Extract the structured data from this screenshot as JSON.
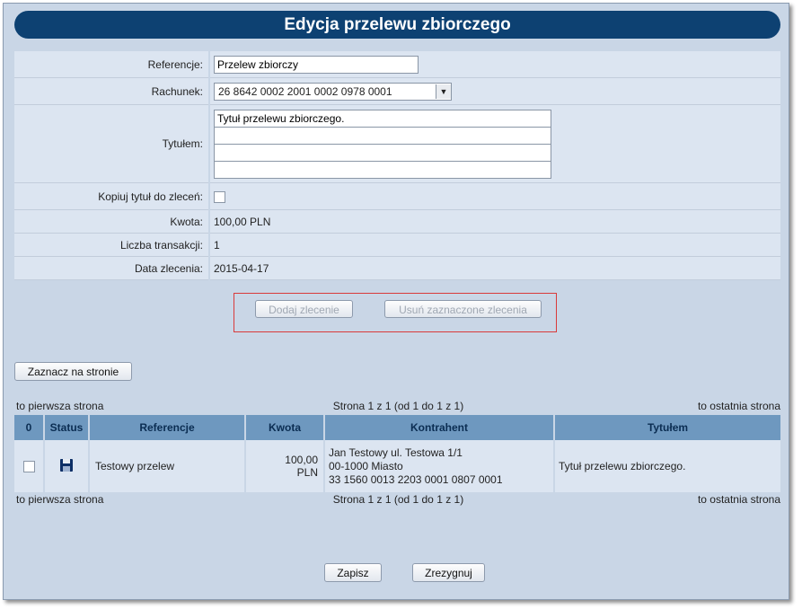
{
  "header": {
    "title": "Edycja przelewu zbiorczego"
  },
  "form": {
    "reference_label": "Referencje:",
    "reference_value": "Przelew zbiorczy",
    "account_label": "Rachunek:",
    "account_value": "26 8642 0002 2001 0002 0978 0001",
    "title_label": "Tytułem:",
    "title_lines": [
      "Tytuł przelewu zbiorczego.",
      "",
      "",
      ""
    ],
    "copy_title_label": "Kopiuj tytuł do zleceń:",
    "amount_label": "Kwota:",
    "amount_value": "100,00 PLN",
    "tx_count_label": "Liczba transakcji:",
    "tx_count_value": "1",
    "date_label": "Data zlecenia:",
    "date_value": "2015-04-17"
  },
  "actions": {
    "add_order": "Dodaj zlecenie",
    "remove_selected": "Usuń zaznaczone zlecenia",
    "select_page": "Zaznacz na stronie"
  },
  "pager": {
    "first": "to pierwsza strona",
    "info": "Strona 1 z 1 (od 1 do 1 z 1)",
    "last": "to ostatnia strona"
  },
  "table": {
    "columns": [
      "0",
      "Status",
      "Referencje",
      "Kwota",
      "Kontrahent",
      "Tytułem"
    ],
    "rows": [
      {
        "status_icon": "floppy-disk-icon",
        "reference": "Testowy przelew",
        "amount_line1": "100,00",
        "amount_line2": "PLN",
        "contractor_line1": "Jan Testowy ul. Testowa 1/1",
        "contractor_line2": "00-1000 Miasto",
        "contractor_line3": "33 1560 0013 2203 0001 0807 0001",
        "title": "Tytuł przelewu zbiorczego."
      }
    ]
  },
  "footer": {
    "save": "Zapisz",
    "cancel": "Zrezygnuj"
  },
  "colors": {
    "title_bar": "#0d4172",
    "panel": "#c9d6e6",
    "row": "#dce5f1",
    "header": "#6e98bf",
    "highlight_box": "#d93a3a"
  }
}
